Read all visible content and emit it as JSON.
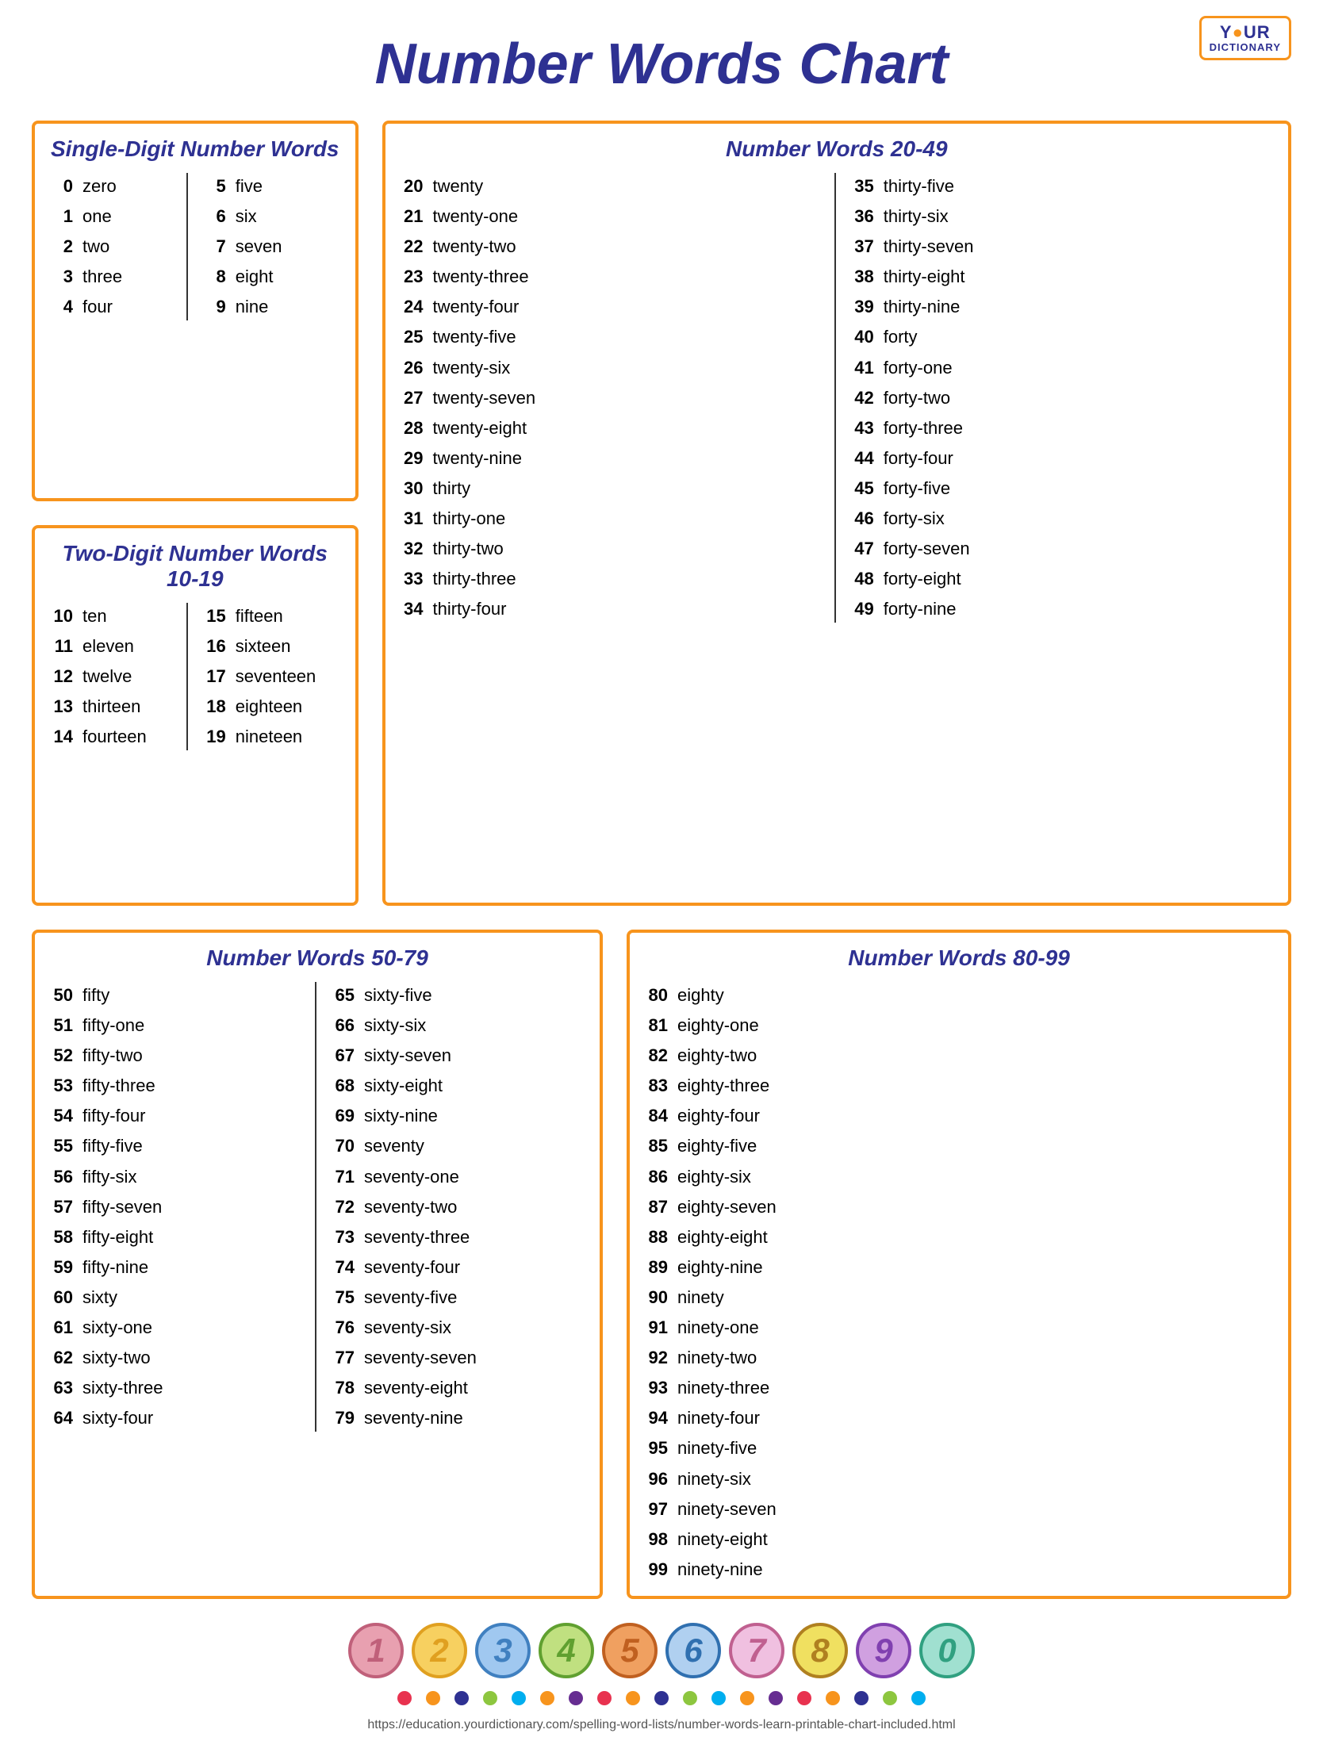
{
  "title": "Number Words Chart",
  "logo": {
    "your": "Y●UR",
    "dictionary": "DICTIONARY",
    "y_color": "#2e3192",
    "dot_color": "#f7941d"
  },
  "sections": {
    "single_digit": {
      "title": "Single-Digit Number Words",
      "col1": [
        {
          "num": "0",
          "word": "zero"
        },
        {
          "num": "1",
          "word": "one"
        },
        {
          "num": "2",
          "word": "two"
        },
        {
          "num": "3",
          "word": "three"
        },
        {
          "num": "4",
          "word": "four"
        }
      ],
      "col2": [
        {
          "num": "5",
          "word": "five"
        },
        {
          "num": "6",
          "word": "six"
        },
        {
          "num": "7",
          "word": "seven"
        },
        {
          "num": "8",
          "word": "eight"
        },
        {
          "num": "9",
          "word": "nine"
        }
      ]
    },
    "two_digit": {
      "title": "Two-Digit Number Words",
      "subtitle": "10-19",
      "col1": [
        {
          "num": "10",
          "word": "ten"
        },
        {
          "num": "11",
          "word": "eleven"
        },
        {
          "num": "12",
          "word": "twelve"
        },
        {
          "num": "13",
          "word": "thirteen"
        },
        {
          "num": "14",
          "word": "fourteen"
        }
      ],
      "col2": [
        {
          "num": "15",
          "word": "fifteen"
        },
        {
          "num": "16",
          "word": "sixteen"
        },
        {
          "num": "17",
          "word": "seventeen"
        },
        {
          "num": "18",
          "word": "eighteen"
        },
        {
          "num": "19",
          "word": "nineteen"
        }
      ]
    },
    "twenty_49": {
      "title": "Number Words 20-49",
      "col1": [
        {
          "num": "20",
          "word": "twenty"
        },
        {
          "num": "21",
          "word": "twenty-one"
        },
        {
          "num": "22",
          "word": "twenty-two"
        },
        {
          "num": "23",
          "word": "twenty-three"
        },
        {
          "num": "24",
          "word": "twenty-four"
        },
        {
          "num": "25",
          "word": "twenty-five"
        },
        {
          "num": "26",
          "word": "twenty-six"
        },
        {
          "num": "27",
          "word": "twenty-seven"
        },
        {
          "num": "28",
          "word": "twenty-eight"
        },
        {
          "num": "29",
          "word": "twenty-nine"
        },
        {
          "num": "30",
          "word": "thirty"
        },
        {
          "num": "31",
          "word": "thirty-one"
        },
        {
          "num": "32",
          "word": "thirty-two"
        },
        {
          "num": "33",
          "word": "thirty-three"
        },
        {
          "num": "34",
          "word": "thirty-four"
        }
      ],
      "col2": [
        {
          "num": "35",
          "word": "thirty-five"
        },
        {
          "num": "36",
          "word": "thirty-six"
        },
        {
          "num": "37",
          "word": "thirty-seven"
        },
        {
          "num": "38",
          "word": "thirty-eight"
        },
        {
          "num": "39",
          "word": "thirty-nine"
        },
        {
          "num": "40",
          "word": "forty"
        },
        {
          "num": "41",
          "word": "forty-one"
        },
        {
          "num": "42",
          "word": "forty-two"
        },
        {
          "num": "43",
          "word": "forty-three"
        },
        {
          "num": "44",
          "word": "forty-four"
        },
        {
          "num": "45",
          "word": "forty-five"
        },
        {
          "num": "46",
          "word": "forty-six"
        },
        {
          "num": "47",
          "word": "forty-seven"
        },
        {
          "num": "48",
          "word": "forty-eight"
        },
        {
          "num": "49",
          "word": "forty-nine"
        }
      ]
    },
    "fifty_79": {
      "title": "Number Words 50-79",
      "col1": [
        {
          "num": "50",
          "word": "fifty"
        },
        {
          "num": "51",
          "word": "fifty-one"
        },
        {
          "num": "52",
          "word": "fifty-two"
        },
        {
          "num": "53",
          "word": "fifty-three"
        },
        {
          "num": "54",
          "word": "fifty-four"
        },
        {
          "num": "55",
          "word": "fifty-five"
        },
        {
          "num": "56",
          "word": "fifty-six"
        },
        {
          "num": "57",
          "word": "fifty-seven"
        },
        {
          "num": "58",
          "word": "fifty-eight"
        },
        {
          "num": "59",
          "word": "fifty-nine"
        },
        {
          "num": "60",
          "word": "sixty"
        },
        {
          "num": "61",
          "word": "sixty-one"
        },
        {
          "num": "62",
          "word": "sixty-two"
        },
        {
          "num": "63",
          "word": "sixty-three"
        },
        {
          "num": "64",
          "word": "sixty-four"
        }
      ],
      "col2": [
        {
          "num": "65",
          "word": "sixty-five"
        },
        {
          "num": "66",
          "word": "sixty-six"
        },
        {
          "num": "67",
          "word": "sixty-seven"
        },
        {
          "num": "68",
          "word": "sixty-eight"
        },
        {
          "num": "69",
          "word": "sixty-nine"
        },
        {
          "num": "70",
          "word": "seventy"
        },
        {
          "num": "71",
          "word": "seventy-one"
        },
        {
          "num": "72",
          "word": "seventy-two"
        },
        {
          "num": "73",
          "word": "seventy-three"
        },
        {
          "num": "74",
          "word": "seventy-four"
        },
        {
          "num": "75",
          "word": "seventy-five"
        },
        {
          "num": "76",
          "word": "seventy-six"
        },
        {
          "num": "77",
          "word": "seventy-seven"
        },
        {
          "num": "78",
          "word": "seventy-eight"
        },
        {
          "num": "79",
          "word": "seventy-nine"
        }
      ]
    },
    "eighty_99": {
      "title": "Number Words 80-99",
      "col1": [
        {
          "num": "80",
          "word": "eighty"
        },
        {
          "num": "81",
          "word": "eighty-one"
        },
        {
          "num": "82",
          "word": "eighty-two"
        },
        {
          "num": "83",
          "word": "eighty-three"
        },
        {
          "num": "84",
          "word": "eighty-four"
        },
        {
          "num": "85",
          "word": "eighty-five"
        },
        {
          "num": "86",
          "word": "eighty-six"
        },
        {
          "num": "87",
          "word": "eighty-seven"
        },
        {
          "num": "88",
          "word": "eighty-eight"
        },
        {
          "num": "89",
          "word": "eighty-nine"
        },
        {
          "num": "90",
          "word": "ninety"
        },
        {
          "num": "91",
          "word": "ninety-one"
        },
        {
          "num": "92",
          "word": "ninety-two"
        },
        {
          "num": "93",
          "word": "ninety-three"
        },
        {
          "num": "94",
          "word": "ninety-four"
        },
        {
          "num": "95",
          "word": "ninety-five"
        },
        {
          "num": "96",
          "word": "ninety-six"
        },
        {
          "num": "97",
          "word": "ninety-seven"
        },
        {
          "num": "98",
          "word": "ninety-eight"
        },
        {
          "num": "99",
          "word": "ninety-nine"
        }
      ]
    }
  },
  "deco_numbers": [
    {
      "digit": "1",
      "bg": "#e8a0b0",
      "border": "#c0607a",
      "color": "#c0607a"
    },
    {
      "digit": "2",
      "bg": "#f7d060",
      "border": "#e0a020",
      "color": "#e0a020"
    },
    {
      "digit": "3",
      "bg": "#a0c8f0",
      "border": "#4080c0",
      "color": "#4080c0"
    },
    {
      "digit": "4",
      "bg": "#c0e080",
      "border": "#60a030",
      "color": "#60a030"
    },
    {
      "digit": "5",
      "bg": "#f0a060",
      "border": "#c06020",
      "color": "#c06020"
    },
    {
      "digit": "6",
      "bg": "#b0d0f0",
      "border": "#3070b0",
      "color": "#3070b0"
    },
    {
      "digit": "7",
      "bg": "#f0c0e0",
      "border": "#c06090",
      "color": "#c06090"
    },
    {
      "digit": "8",
      "bg": "#f0e060",
      "border": "#b08020",
      "color": "#b08020"
    },
    {
      "digit": "9",
      "bg": "#d0a0e0",
      "border": "#8040b0",
      "color": "#8040b0"
    },
    {
      "digit": "0",
      "bg": "#a0e0d0",
      "border": "#30a080",
      "color": "#30a080"
    }
  ],
  "dots": [
    "#e8324f",
    "#f7941d",
    "#2e3192",
    "#8dc63f",
    "#00aeef",
    "#f7941d",
    "#662d91",
    "#e8324f",
    "#f7941d",
    "#2e3192",
    "#8dc63f",
    "#00aeef",
    "#f7941d",
    "#662d91",
    "#e8324f",
    "#f7941d",
    "#2e3192",
    "#8dc63f",
    "#00aeef"
  ],
  "footer_url": "https://education.yourdictionary.com/spelling-word-lists/number-words-learn-printable-chart-included.html"
}
